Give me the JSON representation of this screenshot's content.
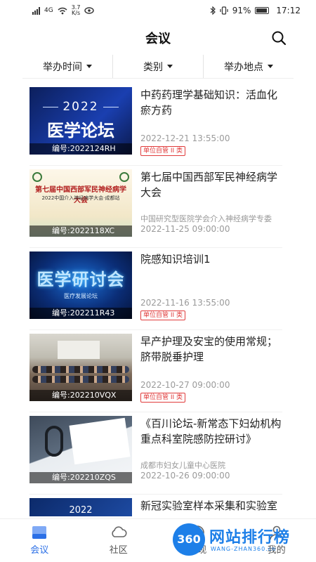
{
  "status_bar": {
    "network": "4G",
    "speed": "3.7",
    "speed_unit": "K/s",
    "battery": "91%",
    "time": "17:12"
  },
  "header": {
    "title": "会议",
    "search_icon": "search-icon"
  },
  "filters": [
    {
      "label": "举办时间"
    },
    {
      "label": "类别"
    },
    {
      "label": "举办地点"
    }
  ],
  "meetings": [
    {
      "title": "中药药理学基础知识：活血化瘀方药",
      "code": "编号:2022124RH",
      "date": "2022-12-21 13:55:00",
      "badge": "单位自管 II 类",
      "thumb_year": "2022",
      "thumb_text": "医学论坛"
    },
    {
      "title": "第七届中国西部军民神经病学大会",
      "code": "编号:2022118XC",
      "organizer": "中国研究型医院学会介入神经病学专委",
      "date": "2022-11-25 09:00:00",
      "thumb_text": "第七届中国西部军民神经病学大会",
      "thumb_sub": "2022中国介入神经病学大会·成都站"
    },
    {
      "title": "院感知识培训1",
      "code": "编号:202211R43",
      "date": "2022-11-16 13:55:00",
      "badge": "单位自管 II 类",
      "thumb_text": "医学研讨会",
      "thumb_sub": "医疗发展论坛"
    },
    {
      "title": "早产护理及安宝的使用常规；脐带脱垂护理",
      "code": "编号:202210VQX",
      "date": "2022-10-27 09:00:00",
      "badge": "单位自管 II 类"
    },
    {
      "title": "《百川论坛-新常态下妇幼机构重点科室院感防控研讨》",
      "code": "编号:202210ZQS",
      "organizer": "成都市妇女儿童中心医院",
      "date": "2022-10-26 09:00:00"
    },
    {
      "title": "新冠实验室样本采集和实验室",
      "thumb_year": "2022"
    }
  ],
  "tabs": [
    {
      "label": "会议",
      "icon": "meeting-icon",
      "active": true
    },
    {
      "label": "社区",
      "icon": "cloud-icon"
    },
    {
      "label": "发现",
      "icon": "discover-icon"
    },
    {
      "label": "我的",
      "icon": "profile-icon"
    }
  ],
  "watermark": {
    "logo": "360",
    "text": "网站排行榜",
    "sub": "WANG-ZHAN360.cn"
  },
  "colors": {
    "accent": "#2b6fe6",
    "badge": "#e03b3b",
    "muted_text": "#999999"
  }
}
